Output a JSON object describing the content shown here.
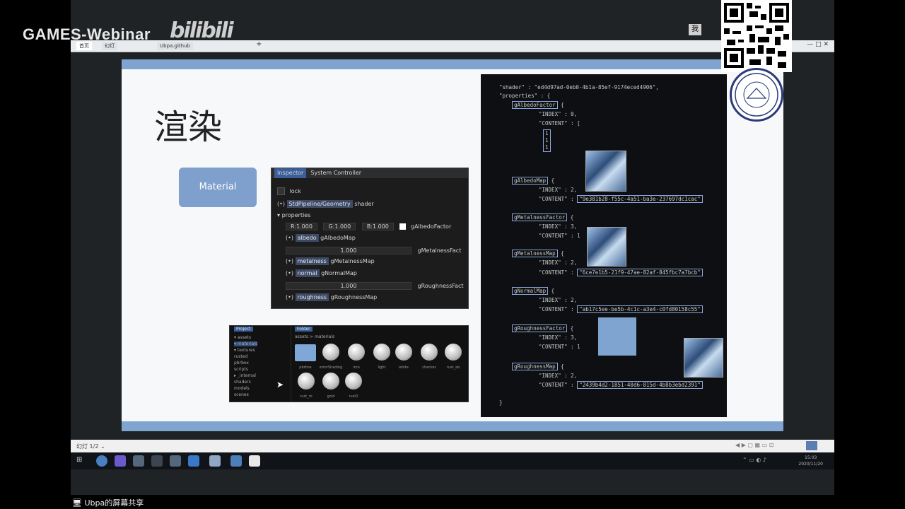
{
  "stream": {
    "brand": "GAMES-Webinar",
    "bilibili": "bilibili",
    "share_label": "Ubpa的屏幕共享",
    "me_label": "我"
  },
  "browser": {
    "tabs": [
      "首页",
      "幻灯",
      "Ubpa.github"
    ],
    "window_controls": "—  □  ✕",
    "bottom_left": "幻灯 1/2 ⌄"
  },
  "slide": {
    "title": "渲染",
    "material_label": "Material",
    "inspector": {
      "tabs": [
        "Inspector",
        "System Controller"
      ],
      "lock": "lock",
      "shader_value": "StdPipeline/Geometry",
      "shader_label": "shader",
      "properties_label": "properties",
      "albedo_factor_values": [
        "R:1.000",
        "G:1.000",
        "B:1.000"
      ],
      "albedo_factor_label": "gAlbedoFactor",
      "albedo_map_chip": "albedo",
      "albedo_map_label": "gAlbedoMap",
      "metalness_factor_value": "1.000",
      "metalness_factor_label": "gMetalnessFact",
      "metalness_map_chip": "metalness",
      "metalness_map_label": "gMetalnessMap",
      "normal_map_chip": "normal",
      "normal_map_label": "gNormalMap",
      "roughness_factor_value": "1.000",
      "roughness_factor_label": "gRoughnessFact",
      "roughness_map_chip": "roughness",
      "roughness_map_label": "gRoughnessMap"
    },
    "project": {
      "tab_left": "Project",
      "tab_right": "Folder",
      "path": "assets > materials",
      "tree": [
        "▾ assets",
        "  ▾ materials",
        "  ▾ textures",
        "     rusted",
        "     pbrbox",
        "  scripts",
        "  ▸ _internal",
        "  shaders",
        "  models",
        "  scenes"
      ],
      "items": [
        "pbrbox",
        "errorShading",
        "iron",
        "light",
        "white",
        "checker",
        "rust_ab",
        "rust_ro",
        "gold",
        "rust2"
      ]
    },
    "code": {
      "shader_line": "\"shader\" : \"ed4d97ad-0eb0-4b1a-85ef-9174eced4906\",",
      "properties_line": "\"properties\" : {",
      "props": [
        {
          "name": "gAlbedoFactor",
          "index": "\"INDEX\" : 0,",
          "content": "\"CONTENT\" : [",
          "guid": ""
        },
        {
          "name": "gAlbedoMap",
          "index": "\"INDEX\" : 2,",
          "content": "\"CONTENT\" :",
          "guid": "\"9e381b28-f55c-4a51-ba3e-237697dc1cac\""
        },
        {
          "name": "gMetalnessFactor",
          "index": "\"INDEX\" : 3,",
          "content": "\"CONTENT\" : 1",
          "guid": ""
        },
        {
          "name": "gMetalnessMap",
          "index": "\"INDEX\" : 2,",
          "content": "\"CONTENT\" :",
          "guid": "\"6ce7e1b5-21f9-47ae-82af-845fbc7a7bcb\""
        },
        {
          "name": "gNormalMap",
          "index": "\"INDEX\" : 2,",
          "content": "\"CONTENT\" :",
          "guid": "\"ab17c5ee-be5b-4c1c-a3e4-c0fd80158c55\""
        },
        {
          "name": "gRoughnessFactor",
          "index": "\"INDEX\" : 3,",
          "content": "\"CONTENT\" : 1",
          "guid": ""
        },
        {
          "name": "gRoughnessMap",
          "index": "\"INDEX\" : 2,",
          "content": "\"CONTENT\" :",
          "guid": "\"2439b4d2-1851-40d6-815d-4b8b3ebd2391\""
        }
      ],
      "array_values": [
        "1",
        "1",
        "1"
      ],
      "closing": "}"
    }
  },
  "taskbar": {
    "time": "15:03",
    "date": "2020/11/20"
  },
  "colors": {
    "slide_accent": "#7fa4cf",
    "material_box": "#7f9fcc",
    "code_bg": "#0d0f12"
  }
}
